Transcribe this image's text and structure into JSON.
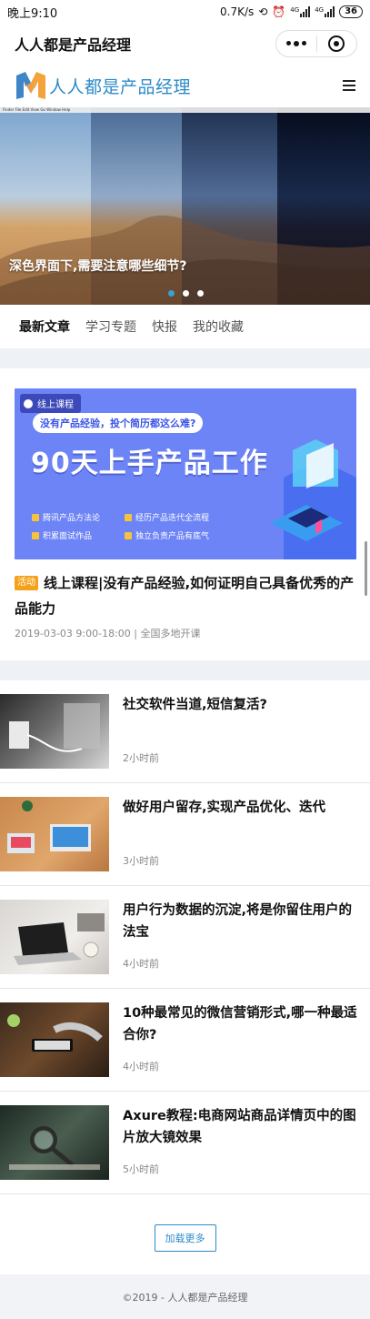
{
  "status_bar": {
    "time": "晚上9:10",
    "speed": "0.7K/s",
    "net1": "4G",
    "net2": "4G",
    "battery": "36"
  },
  "mini_program": {
    "title": "人人都是产品经理"
  },
  "brand": {
    "name": "人人都是产品经理",
    "logo_letter": "M",
    "colors": {
      "primary": "#2c8bc9",
      "logo_orange": "#f2a33a",
      "logo_blue": "#3f86c8"
    }
  },
  "banner": {
    "menubar_text": "Finder  File  Edit  View  Go  Window  Help",
    "title": "深色界面下,需要注意哪些细节?",
    "dots_count": 3,
    "active_dot": 0
  },
  "tabs": [
    {
      "label": "最新文章",
      "active": true
    },
    {
      "label": "学习专题",
      "active": false
    },
    {
      "label": "快报",
      "active": false
    },
    {
      "label": "我的收藏",
      "active": false
    }
  ],
  "course": {
    "chip": "线上课程",
    "question": "没有产品经验，投个简历都这么难?",
    "headline": "90天上手产品工作",
    "features": [
      "腾讯产品方法论",
      "经历产品迭代全流程",
      "积累面试作品",
      "独立负责产品有底气"
    ],
    "badge": "活动",
    "title": "线上课程|没有产品经验,如何证明自己具备优秀的产品能力",
    "meta": "2019-03-03 9:00-18:00 | 全国多地开课"
  },
  "articles": [
    {
      "title": "社交软件当道,短信复活?",
      "time": "2小时前"
    },
    {
      "title": "做好用户留存,实现产品优化、迭代",
      "time": "3小时前"
    },
    {
      "title": "用户行为数据的沉淀,将是你留住用户的法宝",
      "time": "4小时前"
    },
    {
      "title": "10种最常见的微信营销形式,哪一种最适合你?",
      "time": "4小时前"
    },
    {
      "title": "Axure教程:电商网站商品详情页中的图片放大镜效果",
      "time": "5小时前"
    }
  ],
  "load_more": "加载更多",
  "footer": "©2019 - 人人都是产品经理"
}
